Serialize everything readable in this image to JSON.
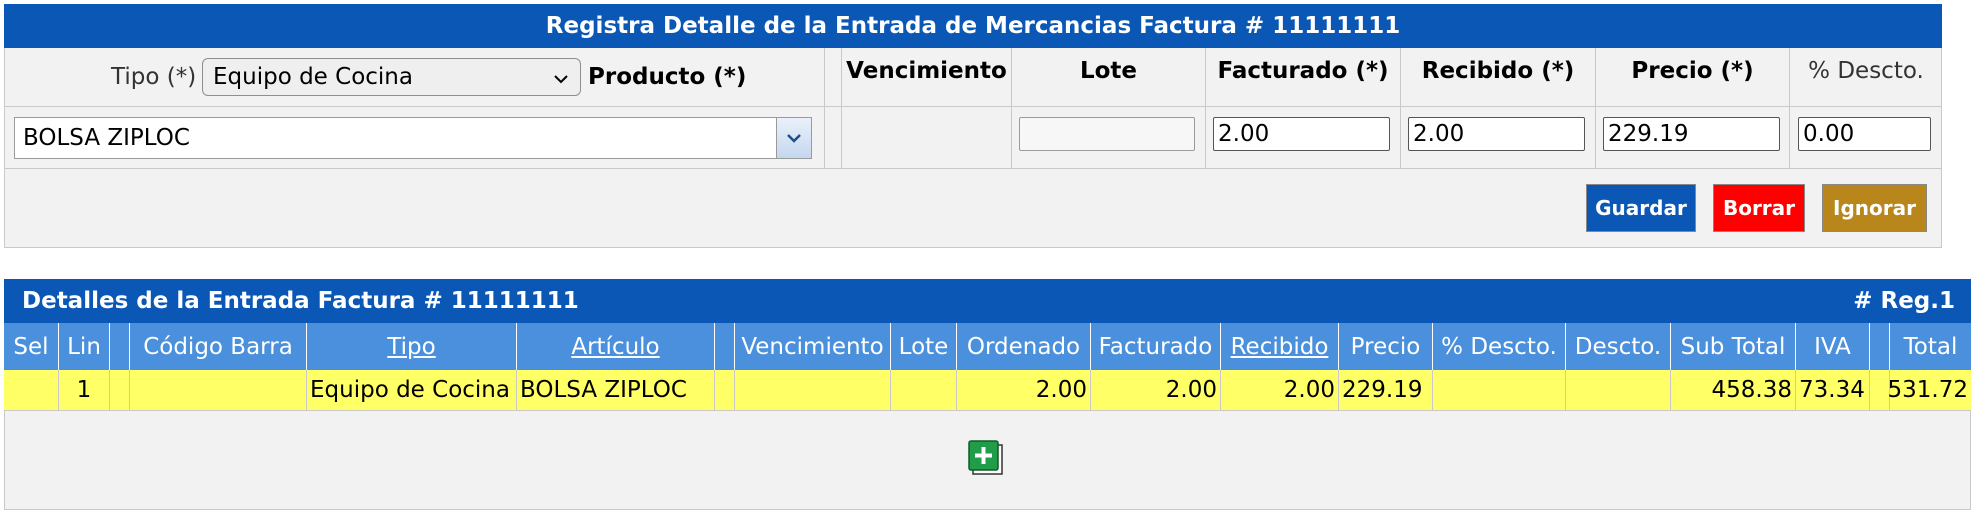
{
  "form": {
    "title": "Registra Detalle de la Entrada de Mercancias Factura # 11111111",
    "tipo_label": "Tipo (*)",
    "tipo_value": "Equipo de Cocina",
    "producto_label": "Producto (*)",
    "producto_value": "BOLSA ZIPLOC",
    "headers": {
      "vencimiento": "Vencimiento",
      "lote": "Lote",
      "facturado": "Facturado (*)",
      "recibido": "Recibido (*)",
      "precio": "Precio (*)",
      "descto": "% Descto."
    },
    "values": {
      "lote": "",
      "facturado": "2.00",
      "recibido": "2.00",
      "precio": "229.19",
      "descto": "0.00"
    },
    "buttons": {
      "guardar": "Guardar",
      "borrar": "Borrar",
      "ignorar": "Ignorar"
    },
    "colors": {
      "header": "#0a57b5",
      "guardar": "#0a57b5",
      "borrar": "#ff0000",
      "ignorar": "#b8861a"
    }
  },
  "details": {
    "title": "Detalles de la Entrada Factura # 11111111",
    "reg_count": "# Reg.1",
    "columns": [
      "Sel",
      "Lin",
      "",
      "Código Barra",
      "Tipo",
      "Artículo",
      "",
      "Vencimiento",
      "Lote",
      "Ordenado",
      "Facturado",
      "Recibido",
      "Precio",
      "% Descto.",
      "Descto.",
      "Sub Total",
      "IVA",
      "",
      "Total"
    ],
    "rows": [
      {
        "sel": "",
        "lin": "1",
        "blank1": "",
        "codigo_barra": "",
        "tipo": "Equipo de Cocina",
        "articulo": "BOLSA ZIPLOC",
        "blank2": "",
        "vencimiento": "",
        "lote": "",
        "ordenado": "2.00",
        "facturado": "2.00",
        "recibido": "2.00",
        "precio": "229.19",
        "pct_descto": "",
        "descto": "",
        "sub_total": "458.38",
        "iva": "73.34",
        "blank3": "",
        "total": "531.72"
      }
    ],
    "add_icon": "add-row-icon",
    "colors": {
      "header_row": "#4a90dc",
      "data_row": "#ffff66"
    }
  }
}
